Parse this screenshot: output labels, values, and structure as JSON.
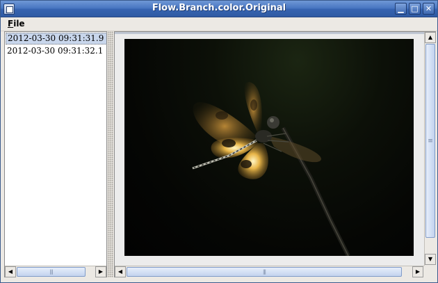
{
  "window": {
    "title": "Flow.Branch.color.Original",
    "minimize_glyph": "▁",
    "maximize_glyph": "□",
    "close_glyph": "✕"
  },
  "menu": {
    "file_mnemonic": "F",
    "file_rest": "ile"
  },
  "list": {
    "items": [
      {
        "label": "2012-03-30 09:31:31.9",
        "selected": true
      },
      {
        "label": "2012-03-30 09:31:32.1",
        "selected": false
      }
    ]
  },
  "scroll": {
    "left_arrow": "◀",
    "right_arrow": "▶",
    "up_arrow": "▲",
    "down_arrow": "▼"
  },
  "image": {
    "subject": "dragonfly on branch",
    "colors": {
      "background": "#050604",
      "wing": "#d9a13a",
      "wing_highlight": "#fff6c4",
      "body": "#2a2a24"
    }
  }
}
